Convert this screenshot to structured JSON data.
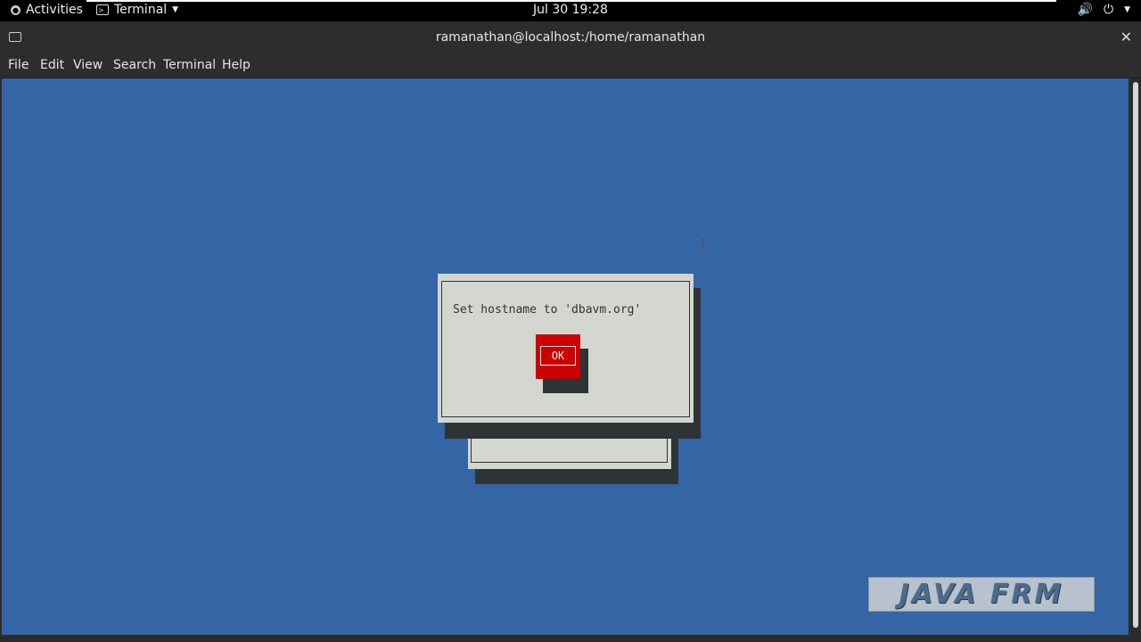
{
  "topbar": {
    "activities": "Activities",
    "app_name": "Terminal",
    "clock": "Jul 30  19:28"
  },
  "window": {
    "title": "ramanathan@localhost:/home/ramanathan"
  },
  "menu": {
    "items": [
      "File",
      "Edit",
      "View",
      "Search",
      "Terminal",
      "Help"
    ]
  },
  "dialog": {
    "message": "Set hostname to 'dbavm.org'",
    "ok_label": "OK"
  },
  "watermark": {
    "text": "JAVA FRM"
  },
  "colors": {
    "terminal_bg": "#3465a4",
    "dialog_bg": "#d3d7cf",
    "button_red": "#cc0000",
    "shadow": "#2e3436"
  }
}
